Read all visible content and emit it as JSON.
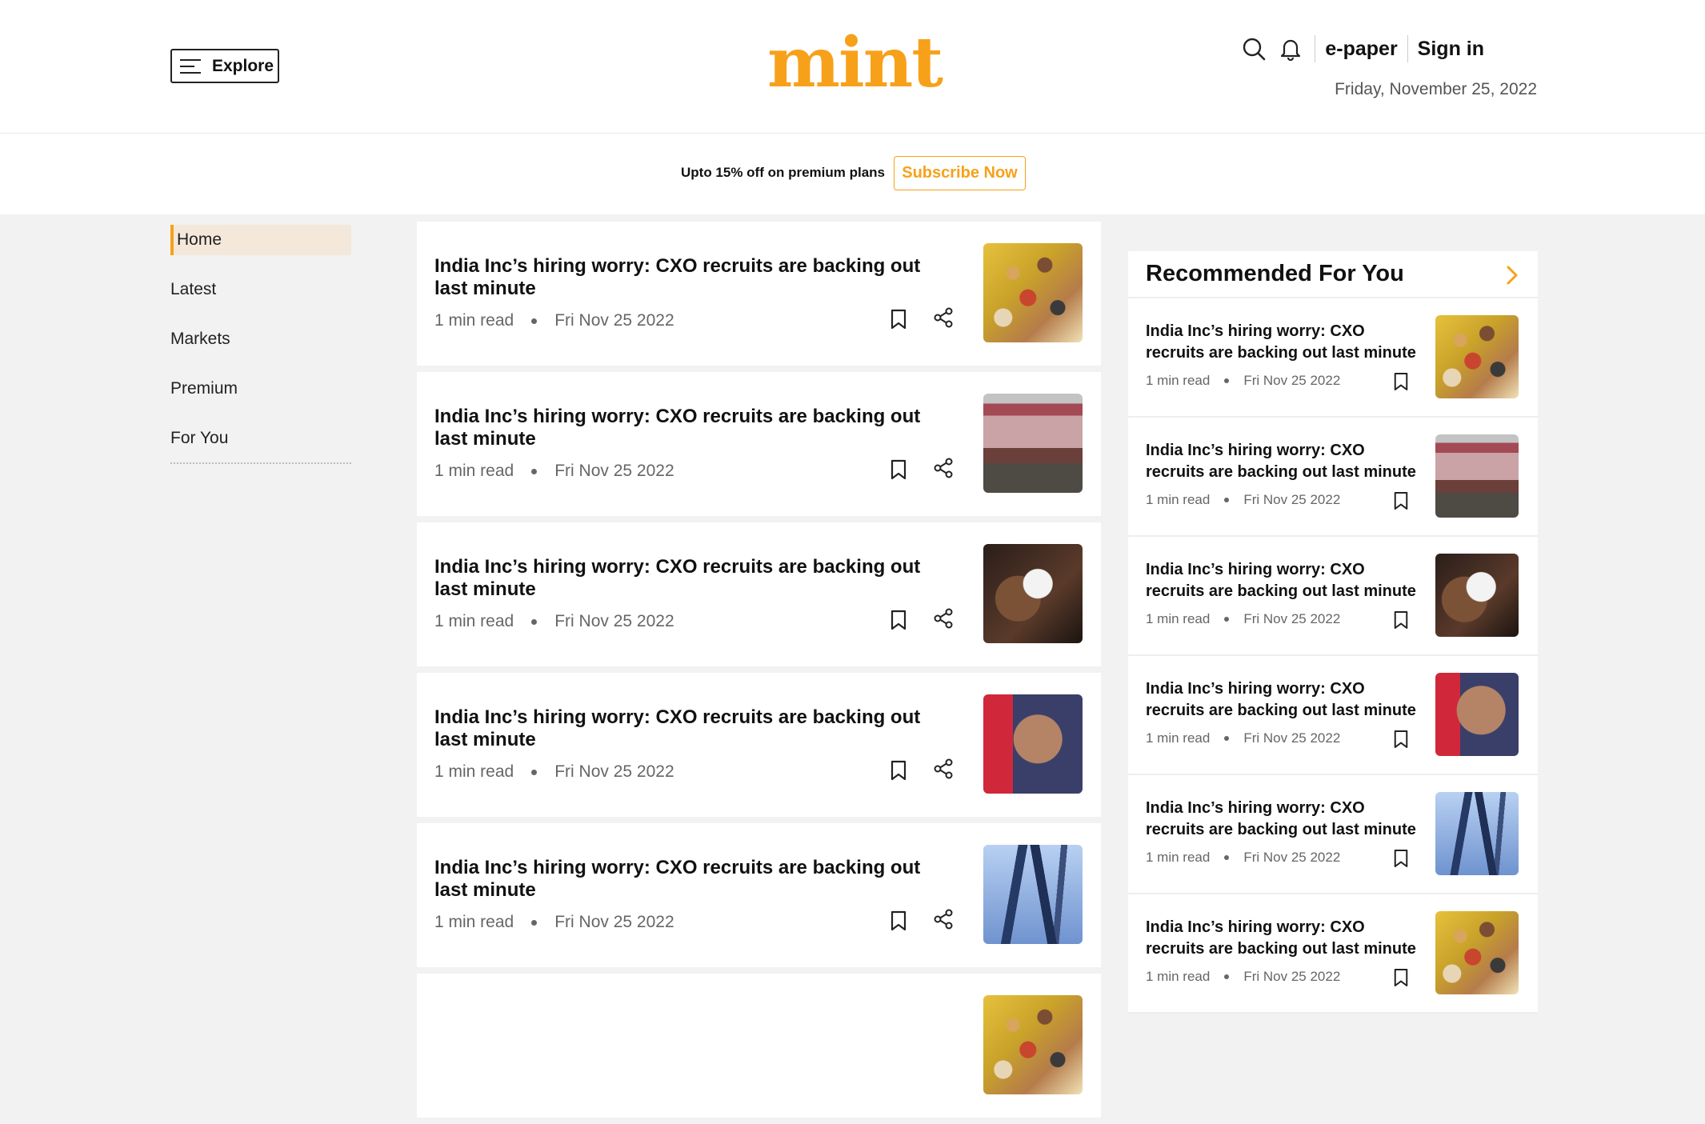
{
  "header": {
    "explore_label": "Explore",
    "logo_text": "mint",
    "epaper_label": "e-paper",
    "signin_label": "Sign in",
    "date": "Friday, November 25, 2022"
  },
  "promo": {
    "text": "Upto 15% off on premium plans",
    "button_label": "Subscribe Now"
  },
  "leftnav": {
    "items": [
      {
        "label": "Home"
      },
      {
        "label": "Latest"
      },
      {
        "label": "Markets"
      },
      {
        "label": "Premium"
      },
      {
        "label": "For You"
      }
    ]
  },
  "feed": {
    "articles": [
      {
        "title": "India Inc’s hiring worry: CXO recruits are backing out last minute",
        "read_time": "1 min read",
        "date": "Fri Nov 25 2022"
      },
      {
        "title": "India Inc’s hiring worry: CXO recruits are backing out last minute",
        "read_time": "1 min read",
        "date": "Fri Nov 25 2022"
      },
      {
        "title": "India Inc’s hiring worry: CXO recruits are backing out last minute",
        "read_time": "1 min read",
        "date": "Fri Nov 25 2022"
      },
      {
        "title": "India Inc’s hiring worry: CXO recruits are backing out last minute",
        "read_time": "1 min read",
        "date": "Fri Nov 25 2022"
      },
      {
        "title": "India Inc’s hiring worry: CXO recruits are backing out last minute",
        "read_time": "1 min read",
        "date": "Fri Nov 25 2022"
      },
      {
        "title": "",
        "read_time": "",
        "date": ""
      }
    ]
  },
  "recommended": {
    "title": "Recommended For You",
    "items": [
      {
        "title": "India Inc’s hiring worry: CXO recruits are backing out last minute",
        "read_time": "1 min read",
        "date": "Fri Nov 25 2022"
      },
      {
        "title": "India Inc’s hiring worry: CXO recruits are backing out last minute",
        "read_time": "1 min read",
        "date": "Fri Nov 25 2022"
      },
      {
        "title": "India Inc’s hiring worry: CXO recruits are backing out last minute",
        "read_time": "1 min read",
        "date": "Fri Nov 25 2022"
      },
      {
        "title": "India Inc’s hiring worry: CXO recruits are backing out last minute",
        "read_time": "1 min read",
        "date": "Fri Nov 25 2022"
      },
      {
        "title": "India Inc’s hiring worry: CXO recruits are backing out last minute",
        "read_time": "1 min read",
        "date": "Fri Nov 25 2022"
      },
      {
        "title": "India Inc’s hiring worry: CXO recruits are backing out last minute",
        "read_time": "1 min read",
        "date": "Fri Nov 25 2022"
      }
    ]
  },
  "icons": {
    "search": "search-icon",
    "notifications": "bell-icon",
    "menu": "hamburger-icon",
    "bookmark": "bookmark-icon",
    "share": "share-icon",
    "next": "chevron-right-icon"
  },
  "colors": {
    "brand": "#f7a11a",
    "active_nav_bg": "#f4e8da",
    "page_bg": "#f2f2f2"
  }
}
